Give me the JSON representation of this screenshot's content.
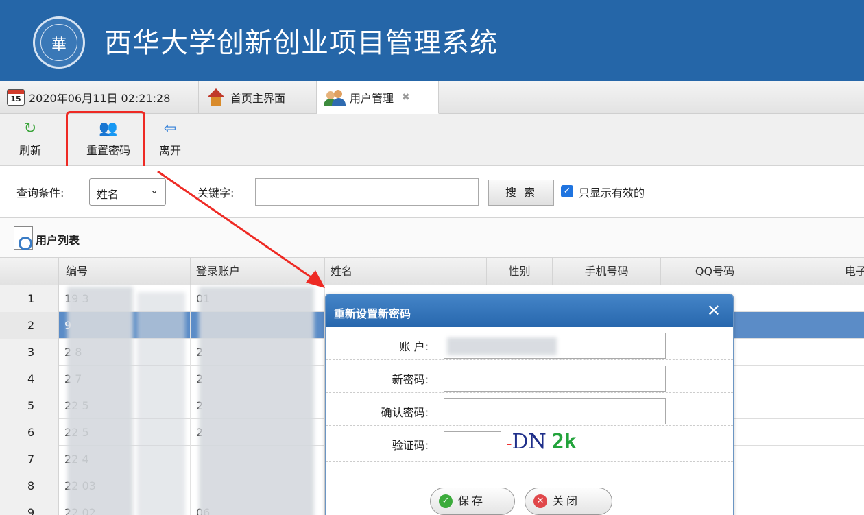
{
  "header": {
    "logo_text": "華",
    "system_title": "西华大学创新创业项目管理系统"
  },
  "tabs": {
    "datetime": "2020年06月11日 02:21:28",
    "calendar_day": "15",
    "home": "首页主界面",
    "user_mgmt": "用户管理"
  },
  "toolbar": {
    "refresh": "刷新",
    "reset_password": "重置密码",
    "leave": "离开"
  },
  "search": {
    "condition_label": "查询条件:",
    "condition_value": "姓名",
    "keyword_label": "关键字:",
    "search_button": "搜 索",
    "only_valid_label": "只显示有效的"
  },
  "list": {
    "title": "用户列表",
    "columns": [
      "编号",
      "登录账户",
      "姓名",
      "性别",
      "手机号码",
      "QQ号码",
      "电子邮件"
    ],
    "rows": [
      {
        "n": "1",
        "id": "19   3",
        "acct": "01"
      },
      {
        "n": "2",
        "id": "9",
        "acct": ""
      },
      {
        "n": "3",
        "id": "2   8",
        "acct": "2"
      },
      {
        "n": "4",
        "id": "2   7",
        "acct": "2"
      },
      {
        "n": "5",
        "id": "22   5",
        "acct": "2"
      },
      {
        "n": "6",
        "id": "22   5",
        "acct": "2"
      },
      {
        "n": "7",
        "id": "22   4",
        "acct": ""
      },
      {
        "n": "8",
        "id": "22   03",
        "acct": ""
      },
      {
        "n": "9",
        "id": "22   02",
        "acct": "06"
      }
    ]
  },
  "dialog": {
    "title": "重新设置新密码",
    "account_label": "账 户:",
    "new_password_label": "新密码:",
    "confirm_password_label": "确认密码:",
    "captcha_label": "验证码:",
    "captcha": {
      "c1": "-",
      "c2": "DN",
      "c3": "2k"
    },
    "save": "保存",
    "close": "关闭"
  },
  "colors": {
    "header": "#2566a8",
    "highlight": "#ee2a24",
    "selected_row": "#5b8cc7"
  }
}
